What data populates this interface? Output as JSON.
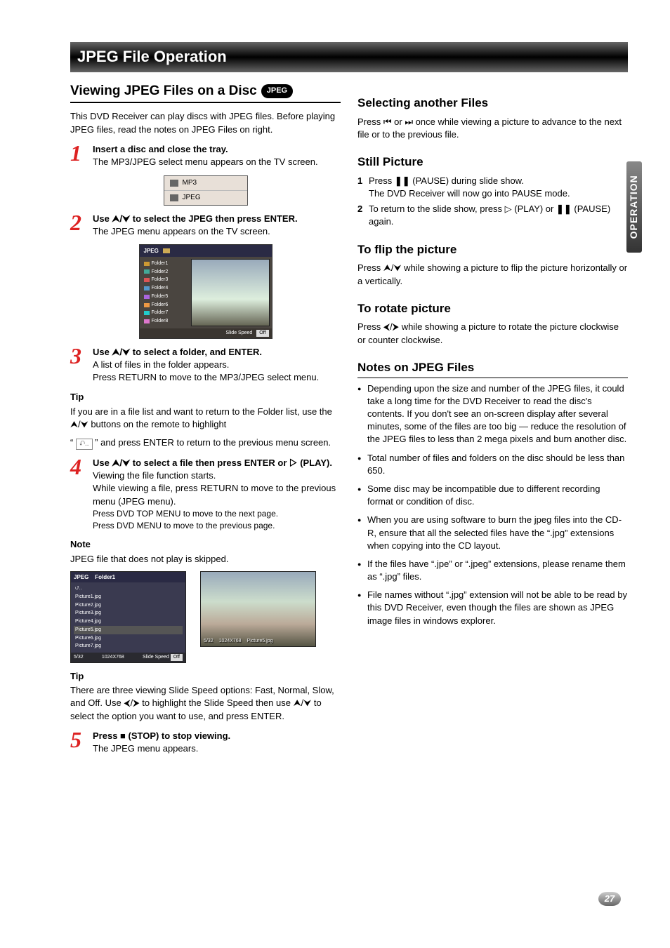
{
  "main_heading": "JPEG File Operation",
  "section_heading": "Viewing JPEG Files on a Disc",
  "jpeg_pill": "JPEG",
  "intro": "This DVD Receiver can play discs with JPEG files. Before playing JPEG files, read the notes on JPEG Files on right.",
  "step1": {
    "title": "Insert a disc and close the tray.",
    "body": "The MP3/JPEG select menu appears on the TV screen."
  },
  "select_menu": {
    "row1": "MP3",
    "row2": "JPEG"
  },
  "step2": {
    "title": "Use ⮝/⮟ to select the JPEG then press ENTER.",
    "body": "The JPEG menu appears on the TV screen."
  },
  "jpeg_menu": {
    "title": "JPEG",
    "folders": [
      "Folder1",
      "Folder2",
      "Folder3",
      "Folder4",
      "Folder5",
      "Folder6",
      "Folder7",
      "Folder8"
    ],
    "slide_speed_label": "Slide Speed",
    "slide_speed_value": "Off"
  },
  "step3": {
    "title": "Use ⮝/⮟ to select a folder, and ENTER.",
    "body1": "A list of files in the folder appears.",
    "body2": "Press RETURN to move to the MP3/JPEG select menu."
  },
  "tip1": {
    "heading": "Tip",
    "body1": "If you are in a file list and want to return to the Folder list, use the ⮝/⮟ buttons on the remote to highlight",
    "body2": "“    ” and press ENTER to return to the previous menu screen."
  },
  "step4": {
    "title": "Use ⮝/⮟ to select a file then press ENTER or ▷ (PLAY).",
    "body1": "Viewing the file function starts.",
    "body2": "While viewing a file, press RETURN to move to the previous menu (JPEG menu).",
    "body3": "Press DVD TOP MENU to move to the next page.",
    "body4": "Press DVD MENU to move to the previous page."
  },
  "note1": {
    "heading": "Note",
    "body": "JPEG file that does not play is skipped."
  },
  "thumb_menu": {
    "header": "JPEG    Folder1",
    "pictures": [
      "Picture1.jpg",
      "Picture2.jpg",
      "Picture3.jpg",
      "Picture4.jpg",
      "Picture5.jpg",
      "Picture6.jpg",
      "Picture7.jpg"
    ],
    "sel_index": 4,
    "footer_left": "5/32",
    "footer_mid": "1024X768",
    "slide_speed_label": "Slide Speed",
    "slide_speed_value": "Off"
  },
  "full_thumb": {
    "left": "5/32",
    "mid": "1024X768",
    "right": "Picture5.jpg"
  },
  "tip2": {
    "heading": "Tip",
    "body": "There are three viewing Slide Speed options: Fast, Normal, Slow, and Off. Use ⮜/⮞ to highlight the Slide Speed then use ⮝/⮟ to select the option you want to use, and press ENTER."
  },
  "step5": {
    "title": "Press ■ (STOP) to stop viewing.",
    "body": "The JPEG menu appears."
  },
  "selecting": {
    "heading": "Selecting another Files",
    "body": "Press ⏮ or ⏭ once while viewing a picture to advance to the next file or to the previous file."
  },
  "still": {
    "heading": "Still Picture",
    "li1a": "Press ",
    "li1pause": "❚❚",
    "li1b": " (PAUSE) during slide show.",
    "li1c": "The DVD Receiver will now go into PAUSE mode.",
    "li2a": "To return to the slide show, press ▷ (PLAY) or ",
    "li2pause": "❚❚",
    "li2b": " (PAUSE) again."
  },
  "flip": {
    "heading": "To flip the picture",
    "body": "Press ⮝/⮟ while showing a picture to flip the picture horizontally or a vertically."
  },
  "rotate": {
    "heading": "To rotate picture",
    "body": "Press ⮜/⮞ while showing a picture to rotate the picture clockwise or counter clockwise."
  },
  "notes": {
    "heading": "Notes on JPEG Files",
    "li1": "Depending upon the size and number of the JPEG files, it could take a long time for the DVD Receiver to read the disc's contents. If you don't see an on-screen display after several minutes, some of the files are too big — reduce the resolution of the JPEG files to less than 2 mega pixels and burn another disc.",
    "li2": "Total number of files and folders on the disc should be less than 650.",
    "li3": "Some disc may be incompatible due to different recording format or condition of disc.",
    "li4": "When you are using software to burn the jpeg files into the CD-R, ensure that all the selected files have the “.jpg” extensions when copying into the CD layout.",
    "li5": "If the files have “.jpe” or “.jpeg” extensions, please rename them as “.jpg” files.",
    "li6": "File names without “.jpg” extension will not be able to be read by this DVD Receiver, even though the files are shown as JPEG image files in windows explorer."
  },
  "side_tab": "OPERATION",
  "page_num": "27"
}
